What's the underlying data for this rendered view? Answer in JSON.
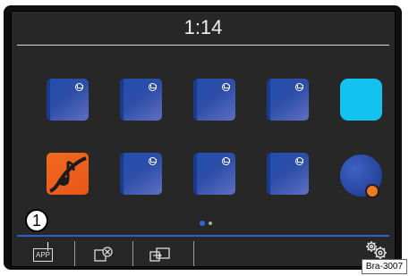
{
  "status": {
    "time": "1:14"
  },
  "apps": {
    "row1": [
      "vw-app",
      "vw-app",
      "vw-app",
      "vw-app",
      "cyan-app"
    ],
    "row2": [
      "music-app",
      "vw-app",
      "vw-app",
      "vw-app",
      "circle-app"
    ]
  },
  "pager": {
    "page_count": 2,
    "current_page": 1
  },
  "bottom_bar": {
    "app_label": "APP",
    "icons": [
      "app-icon",
      "close-window-icon",
      "screen-switch-icon",
      "settings-icon"
    ]
  },
  "annotations": {
    "callout": "1",
    "figure_ref": "Bra-3007"
  },
  "colors": {
    "accent_blue": "#2b5fd0",
    "cyan": "#14c2f0",
    "orange": "#f07a22"
  }
}
